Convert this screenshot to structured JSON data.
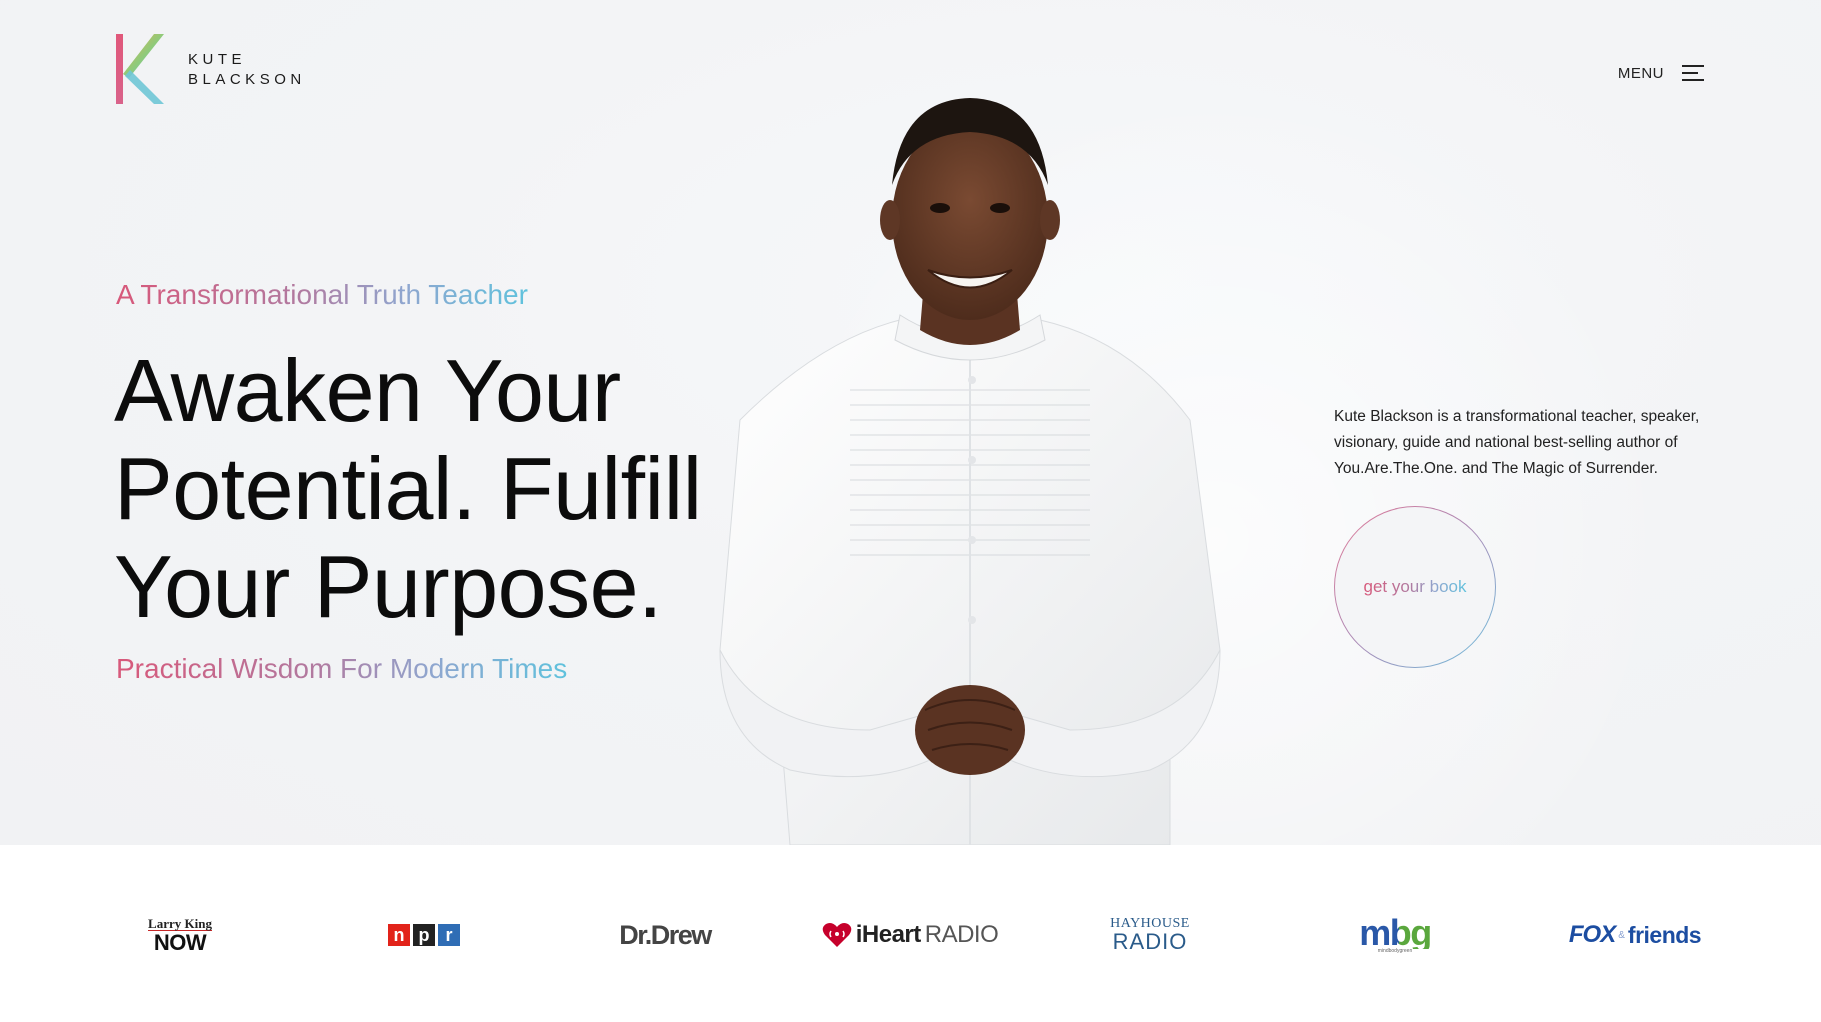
{
  "brand": {
    "logo_letter": "K",
    "name_line1": "KUTE",
    "name_line2": "BLACKSON"
  },
  "nav": {
    "menu_label": "MENU"
  },
  "hero": {
    "kicker": "A Transformational Truth Teacher",
    "headline": "Awaken Your Potential. Fulfill Your Purpose.",
    "tagline": "Practical Wisdom For Modern Times",
    "portrait_alt": "Kute Blackson portrait"
  },
  "about": {
    "bio": "Kute Blackson is a transformational teacher, speaker, visionary, guide and national best-selling author of You.Are.The.One. and The Magic of Surrender.",
    "cta_label": "get your book"
  },
  "press": {
    "larry_king_line1": "Larry King",
    "larry_king_line2": "NOW",
    "npr_n": "n",
    "npr_p": "p",
    "npr_r": "r",
    "dr_drew": "Dr.Drew",
    "iheart_bold": "iHeart",
    "iheart_regular": "RADIO",
    "hayhouse_line1": "HAYHOUSE",
    "hayhouse_line2": "RADIO",
    "mbg": "mbg",
    "mbg_sub": "mindbodygreen",
    "fox_line1": "FOX",
    "fox_amp": "&",
    "fox_line2": "friends"
  },
  "colors": {
    "gradient_pink": "#d8587a",
    "gradient_blue": "#5fc2dd",
    "text_dark": "#0c0c0c"
  }
}
